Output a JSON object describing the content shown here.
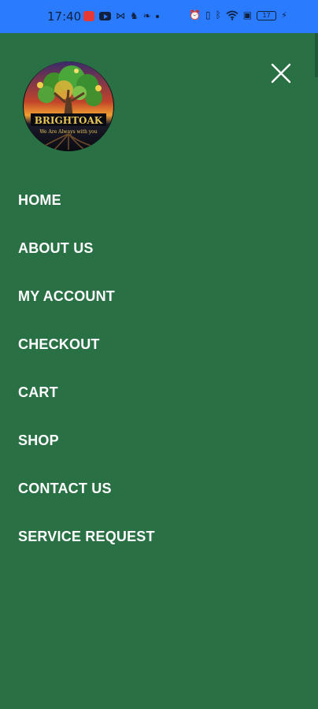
{
  "status_bar": {
    "time": "17:40",
    "battery_level": "17",
    "icons_left": [
      "notification-red-icon",
      "youtube-icon",
      "mail-icon",
      "bird-icon",
      "leaf-icon",
      "dot-icon"
    ],
    "icons_right": [
      "alarm-icon",
      "vibrate-icon",
      "bluetooth-icon",
      "wifi-icon",
      "sim-icon",
      "battery-icon",
      "charging-icon"
    ]
  },
  "drawer": {
    "background_color": "#2a7045",
    "close_icon": "close-icon",
    "logo": {
      "brand": "BRIGHTOAK",
      "tagline": "We Are Always with you"
    },
    "menu_items": [
      {
        "label": "HOME"
      },
      {
        "label": "ABOUT US"
      },
      {
        "label": "MY ACCOUNT"
      },
      {
        "label": "CHECKOUT"
      },
      {
        "label": "CART"
      },
      {
        "label": "SHOP"
      },
      {
        "label": "CONTACT US"
      },
      {
        "label": "SERVICE REQUEST"
      }
    ]
  }
}
